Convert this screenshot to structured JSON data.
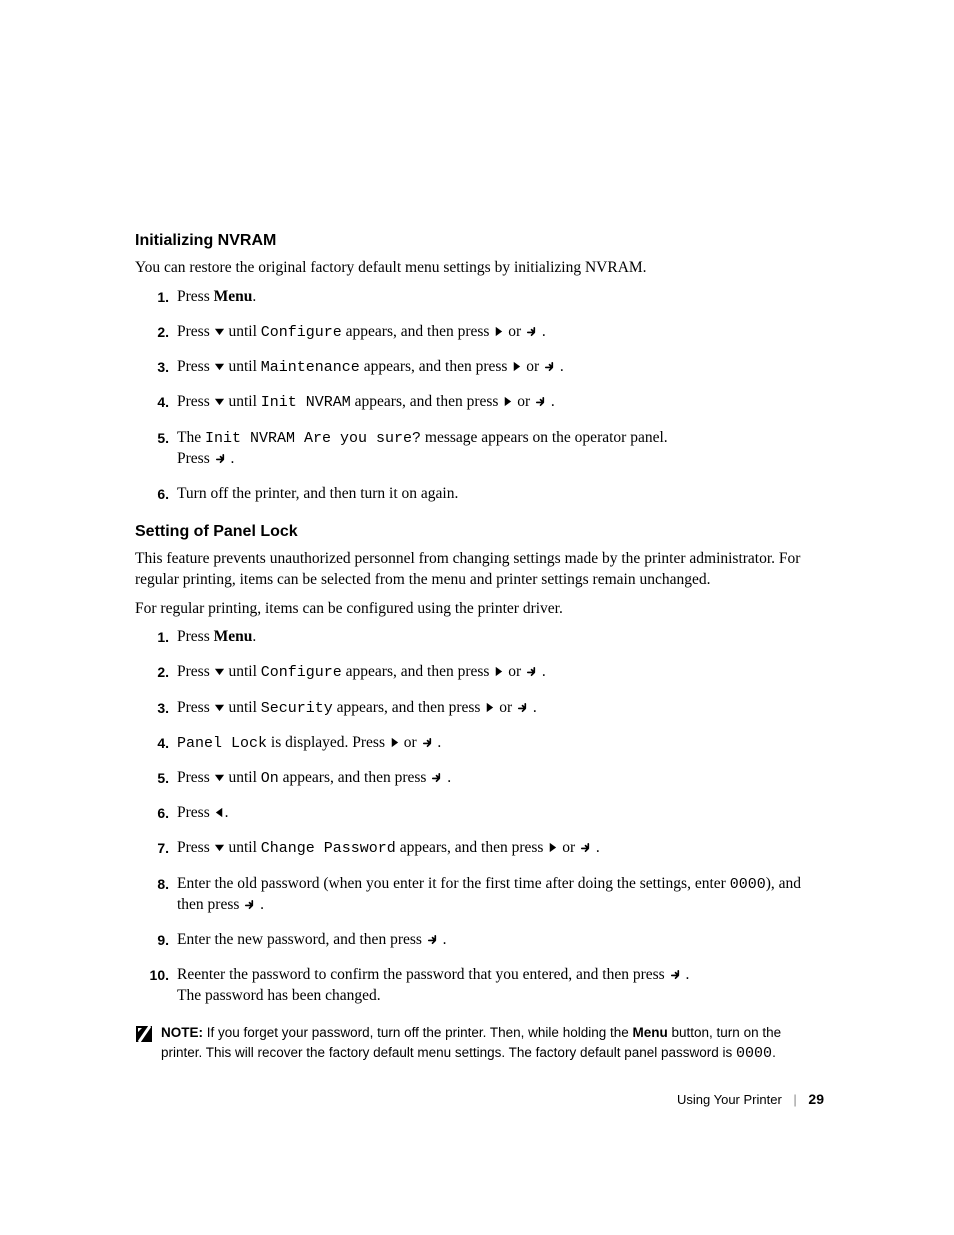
{
  "section1": {
    "heading": "Initializing NVRAM",
    "intro": "You can restore the original factory default menu settings by initializing NVRAM.",
    "steps": [
      {
        "n": "1.",
        "pre": "Press ",
        "bold": "Menu",
        "post": "."
      },
      {
        "n": "2.",
        "pre": "Press ",
        "icon1": "down",
        "mid1": " until ",
        "mono1": "Configure",
        "mid2": " appears, and then press ",
        "icon2": "right",
        "mid3": " or ",
        "icon3": "enter",
        "post": " ."
      },
      {
        "n": "3.",
        "pre": "Press ",
        "icon1": "down",
        "mid1": " until ",
        "mono1": "Maintenance",
        "mid2": " appears, and then press ",
        "icon2": "right",
        "mid3": " or ",
        "icon3": "enter",
        "post": " ."
      },
      {
        "n": "4.",
        "pre": "Press ",
        "icon1": "down",
        "mid1": " until ",
        "mono1": "Init NVRAM",
        "mid2": " appears, and then press ",
        "icon2": "right",
        "mid3": " or ",
        "icon3": "enter",
        "post": " ."
      },
      {
        "n": "5.",
        "line1a": "The ",
        "line1mono": "Init NVRAM Are you sure?",
        "line1b": " message appears on the operator panel.",
        "line2a": "Press ",
        "line2icon": "enter",
        "line2b": " ."
      },
      {
        "n": "6.",
        "pre": "Turn off the printer, and then turn it on again."
      }
    ]
  },
  "section2": {
    "heading": "Setting of Panel Lock",
    "intro1": "This feature prevents unauthorized personnel from changing settings made by the printer administrator. For regular printing, items can be selected from the menu and printer settings remain unchanged.",
    "intro2": "For regular printing, items can be configured using the printer driver.",
    "steps": [
      {
        "n": "1.",
        "pre": "Press ",
        "bold": "Menu",
        "post": "."
      },
      {
        "n": "2.",
        "pre": "Press ",
        "icon1": "down",
        "mid1": " until ",
        "mono1": "Configure",
        "mid2": " appears, and then press ",
        "icon2": "right",
        "mid3": " or ",
        "icon3": "enter",
        "post": " ."
      },
      {
        "n": "3.",
        "pre": "Press ",
        "icon1": "down",
        "mid1": " until ",
        "mono1": "Security",
        "mid2": " appears, and then press ",
        "icon2": "right",
        "mid3": " or ",
        "icon3": "enter",
        "post": " ."
      },
      {
        "n": "4.",
        "mono1": "Panel Lock",
        "mid1": " is displayed. Press ",
        "icon1": "right",
        "mid2": " or ",
        "icon2": "enter",
        "post": " ."
      },
      {
        "n": "5.",
        "pre": "Press ",
        "icon1": "down",
        "mid1": " until ",
        "mono1": "On",
        "mid2": " appears, and then press ",
        "icon2": "enter",
        "post": " ."
      },
      {
        "n": "6.",
        "pre": "Press ",
        "icon1": "left",
        "post": "."
      },
      {
        "n": "7.",
        "pre": "Press ",
        "icon1": "down",
        "mid1": " until ",
        "mono1": "Change Password",
        "mid2": " appears, and then press ",
        "icon2": "right",
        "mid3": " or ",
        "icon3": "enter",
        "post": " ."
      },
      {
        "n": "8.",
        "pre": "Enter the old password (when you enter it for the first time after doing the settings, enter ",
        "mono1": "0000",
        "mid1": "), and then press ",
        "icon1": "enter",
        "post": " ."
      },
      {
        "n": "9.",
        "pre": "Enter the new password, and then press ",
        "icon1": "enter",
        "post": " ."
      },
      {
        "n": "10.",
        "pre": "Reenter the password to confirm the password that you entered, and then press ",
        "icon1": "enter",
        "post": " .",
        "line2": "The password has been changed."
      }
    ]
  },
  "note": {
    "label": "NOTE: ",
    "text1": "If you forget your password, turn off the printer. Then, while holding the ",
    "bold": "Menu",
    "text2": " button, turn on the printer. This will recover the factory default menu settings. The factory default panel password is ",
    "mono": "0000",
    "text3": "."
  },
  "footer": {
    "chapter": "Using Your Printer",
    "page": "29"
  }
}
